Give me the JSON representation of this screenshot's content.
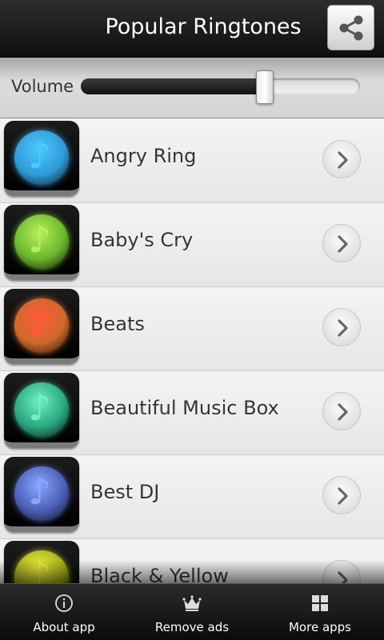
{
  "header": {
    "title": "Popular Ringtones",
    "share_icon": "share-icon"
  },
  "volume": {
    "label": "Volume",
    "level": 0.66
  },
  "ringtones": [
    {
      "name": "Angry Ring",
      "color": "#2f9bd8",
      "note_color": "#4cc8ff"
    },
    {
      "name": "Baby's Cry",
      "color": "#6ab82d",
      "note_color": "#b8f05a"
    },
    {
      "name": "Beats",
      "color": "#d06a2c",
      "note_color": "#ff5a3a"
    },
    {
      "name": "Beautiful Music Box",
      "color": "#2aa882",
      "note_color": "#6ff0c0"
    },
    {
      "name": "Best DJ",
      "color": "#4a5fb8",
      "note_color": "#8aa6ff"
    },
    {
      "name": "Black & Yellow",
      "color": "#a5b01a",
      "note_color": "#f0f040"
    }
  ],
  "bottom_tabs": [
    {
      "label": "About app",
      "icon": "info-icon"
    },
    {
      "label": "Remove ads",
      "icon": "crown-icon"
    },
    {
      "label": "More apps",
      "icon": "grid-icon"
    }
  ]
}
